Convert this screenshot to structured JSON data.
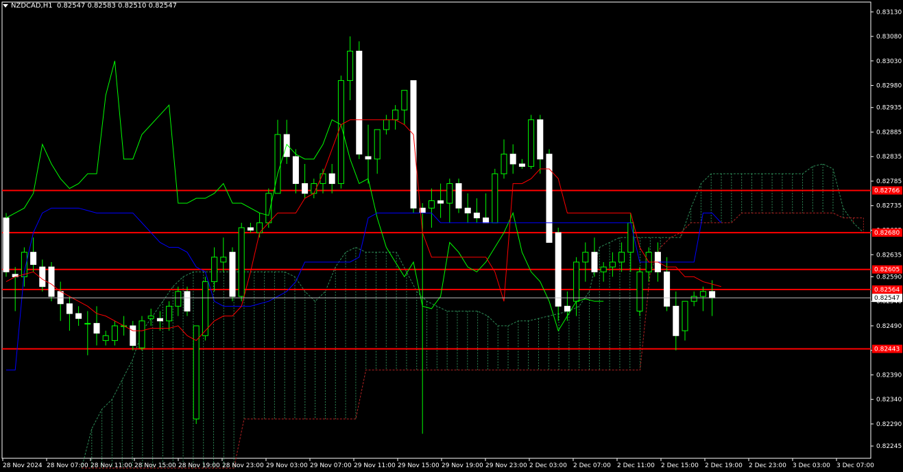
{
  "header": {
    "symbol": "NZDCAD,H1",
    "ohlc": "0.82547 0.82583 0.82510 0.82547"
  },
  "colors": {
    "background": "#000000",
    "frame": "#ffffff",
    "bull_body": "#000000",
    "bull_wick": "#00ff00",
    "bear_body": "#ffffff",
    "tenkan": "#ff0000",
    "kijun": "#0000ff",
    "chikou": "#00ff00",
    "senkou_a": "#2e8b57",
    "senkou_b": "#b22222",
    "level_line": "#ff0000",
    "level_label": "#ff0000",
    "price_label": "#ffffff"
  },
  "chart_data": {
    "type": "candlestick",
    "ylim": [
      0.8222,
      0.8315
    ],
    "y_ticks": [
      "0.83130",
      "0.83080",
      "0.83030",
      "0.82980",
      "0.82935",
      "0.82885",
      "0.82835",
      "0.82785",
      "0.82735",
      "0.82685",
      "0.82635",
      "0.82590",
      "0.82540",
      "0.82490",
      "0.82440",
      "0.82390",
      "0.82340",
      "0.82290",
      "0.82245"
    ],
    "x_labels": [
      "28 Nov 2024",
      "28 Nov 07:00",
      "28 Nov 11:00",
      "28 Nov 15:00",
      "28 Nov 19:00",
      "28 Nov 23:00",
      "29 Nov 03:00",
      "29 Nov 07:00",
      "29 Nov 11:00",
      "29 Nov 15:00",
      "29 Nov 19:00",
      "29 Nov 23:00",
      "2 Dec 03:00",
      "2 Dec 07:00",
      "2 Dec 11:00",
      "2 Dec 15:00",
      "2 Dec 19:00",
      "2 Dec 23:00",
      "3 Dec 03:00",
      "3 Dec 07:00"
    ],
    "candles": [
      [
        0.8271,
        0.8272,
        0.8259,
        0.826
      ],
      [
        0.82595,
        0.8261,
        0.8252,
        0.8259
      ],
      [
        0.8259,
        0.8265,
        0.8257,
        0.8264
      ],
      [
        0.8264,
        0.8267,
        0.826,
        0.82615
      ],
      [
        0.8261,
        0.82625,
        0.8256,
        0.8257
      ],
      [
        0.8261,
        0.8262,
        0.8254,
        0.8255
      ],
      [
        0.8256,
        0.8258,
        0.825,
        0.82535
      ],
      [
        0.82535,
        0.8255,
        0.8248,
        0.82515
      ],
      [
        0.82515,
        0.8253,
        0.8249,
        0.82505
      ],
      [
        0.82495,
        0.8252,
        0.8243,
        0.82495
      ],
      [
        0.82495,
        0.8253,
        0.8245,
        0.82475
      ],
      [
        0.8246,
        0.8248,
        0.8245,
        0.8247
      ],
      [
        0.8246,
        0.825,
        0.8245,
        0.8249
      ],
      [
        0.8249,
        0.8251,
        0.8247,
        0.8249
      ],
      [
        0.8249,
        0.825,
        0.8244,
        0.8245
      ],
      [
        0.82445,
        0.8251,
        0.8244,
        0.825
      ],
      [
        0.82505,
        0.82525,
        0.8249,
        0.8251
      ],
      [
        0.82505,
        0.8252,
        0.8248,
        0.825
      ],
      [
        0.825,
        0.8254,
        0.8248,
        0.8253
      ],
      [
        0.8253,
        0.8257,
        0.8251,
        0.8256
      ],
      [
        0.8256,
        0.8257,
        0.8251,
        0.8252
      ],
      [
        0.823,
        0.8249,
        0.8229,
        0.8249
      ],
      [
        0.8247,
        0.8259,
        0.8246,
        0.8258
      ],
      [
        0.8258,
        0.8265,
        0.8256,
        0.8263
      ],
      [
        0.8262,
        0.8267,
        0.826,
        0.8263
      ],
      [
        0.8264,
        0.8265,
        0.8254,
        0.8255
      ],
      [
        0.8255,
        0.827,
        0.8254,
        0.8269
      ],
      [
        0.8269,
        0.827,
        0.8268,
        0.82685
      ],
      [
        0.8268,
        0.8272,
        0.8267,
        0.827
      ],
      [
        0.827,
        0.8277,
        0.8269,
        0.8276
      ],
      [
        0.8276,
        0.8291,
        0.8276,
        0.8288
      ],
      [
        0.8288,
        0.8291,
        0.8282,
        0.82835
      ],
      [
        0.82835,
        0.8285,
        0.8276,
        0.8278
      ],
      [
        0.8278,
        0.8282,
        0.8275,
        0.8276
      ],
      [
        0.8276,
        0.8279,
        0.8275,
        0.8278
      ],
      [
        0.8278,
        0.8281,
        0.8276,
        0.828
      ],
      [
        0.828,
        0.8282,
        0.8276,
        0.8278
      ],
      [
        0.8278,
        0.83,
        0.8277,
        0.8299
      ],
      [
        0.8299,
        0.8308,
        0.8295,
        0.8305
      ],
      [
        0.8305,
        0.8307,
        0.8283,
        0.8284
      ],
      [
        0.82835,
        0.829,
        0.8278,
        0.8283
      ],
      [
        0.8283,
        0.8289,
        0.828,
        0.8289
      ],
      [
        0.8289,
        0.8292,
        0.8288,
        0.8291
      ],
      [
        0.8291,
        0.8294,
        0.8289,
        0.8293
      ],
      [
        0.8293,
        0.8297,
        0.829,
        0.8297
      ],
      [
        0.8299,
        0.8299,
        0.8272,
        0.8273
      ],
      [
        0.8273,
        0.8274,
        0.8227,
        0.8272
      ],
      [
        0.8273,
        0.8277,
        0.8269,
        0.82745
      ],
      [
        0.82745,
        0.8278,
        0.8271,
        0.8274
      ],
      [
        0.8274,
        0.8279,
        0.827,
        0.8278
      ],
      [
        0.8278,
        0.8279,
        0.8272,
        0.8273
      ],
      [
        0.8273,
        0.8276,
        0.827,
        0.8272
      ],
      [
        0.8272,
        0.8275,
        0.827,
        0.8271
      ],
      [
        0.8271,
        0.8276,
        0.827,
        0.827
      ],
      [
        0.827,
        0.8281,
        0.827,
        0.828
      ],
      [
        0.828,
        0.8287,
        0.8279,
        0.8284
      ],
      [
        0.8284,
        0.8286,
        0.828,
        0.8282
      ],
      [
        0.8282,
        0.8283,
        0.8281,
        0.82815
      ],
      [
        0.82815,
        0.8292,
        0.8281,
        0.8291
      ],
      [
        0.8291,
        0.8292,
        0.828,
        0.8283
      ],
      [
        0.8284,
        0.8285,
        0.8272,
        0.8266
      ],
      [
        0.8268,
        0.8269,
        0.825,
        0.8253
      ],
      [
        0.8253,
        0.8256,
        0.825,
        0.8252
      ],
      [
        0.8254,
        0.8263,
        0.8251,
        0.8262
      ],
      [
        0.8262,
        0.8266,
        0.8258,
        0.8264
      ],
      [
        0.8264,
        0.8267,
        0.8259,
        0.826
      ],
      [
        0.826,
        0.8262,
        0.8258,
        0.8261
      ],
      [
        0.8261,
        0.8264,
        0.8259,
        0.8262
      ],
      [
        0.8262,
        0.8266,
        0.826,
        0.8264
      ],
      [
        0.8264,
        0.8272,
        0.826,
        0.827
      ],
      [
        0.8252,
        0.8261,
        0.8251,
        0.826
      ],
      [
        0.826,
        0.8265,
        0.8258,
        0.8264
      ],
      [
        0.8264,
        0.8266,
        0.8258,
        0.826
      ],
      [
        0.826,
        0.8263,
        0.8252,
        0.8253
      ],
      [
        0.8253,
        0.8256,
        0.8244,
        0.8247
      ],
      [
        0.8248,
        0.8254,
        0.8246,
        0.8254
      ],
      [
        0.8254,
        0.8256,
        0.8253,
        0.8255
      ],
      [
        0.8255,
        0.8257,
        0.8252,
        0.8256
      ],
      [
        0.8256,
        0.82583,
        0.8251,
        0.82547
      ]
    ],
    "tenkan": [
      0.8258,
      0.8259,
      0.82595,
      0.826,
      0.82585,
      0.82575,
      0.8256,
      0.8255,
      0.8254,
      0.8253,
      0.82515,
      0.8251,
      0.825,
      0.8249,
      0.8248,
      0.8248,
      0.82485,
      0.82485,
      0.82485,
      0.8249,
      0.8247,
      0.8246,
      0.8248,
      0.825,
      0.8251,
      0.8251,
      0.8253,
      0.826,
      0.8268,
      0.827,
      0.8272,
      0.8272,
      0.8272,
      0.8275,
      0.8276,
      0.828,
      0.8285,
      0.829,
      0.8291,
      0.8291,
      0.8291,
      0.8291,
      0.8291,
      0.8291,
      0.829,
      0.8288,
      0.8268,
      0.8263,
      0.8263,
      0.8263,
      0.8263,
      0.8263,
      0.8263,
      0.8263,
      0.826,
      0.8254,
      0.8278,
      0.8278,
      0.8279,
      0.8281,
      0.8281,
      0.8279,
      0.8272,
      0.8272,
      0.8272,
      0.8272,
      0.8272,
      0.8272,
      0.8272,
      0.8272,
      0.8265,
      0.8262,
      0.8262,
      0.8261,
      0.8261,
      0.8259,
      0.8259,
      0.8258,
      0.82575,
      0.8257
    ],
    "kijun": [
      0.824,
      0.824,
      0.826,
      0.8268,
      0.8272,
      0.8273,
      0.8273,
      0.8273,
      0.8273,
      0.82725,
      0.8272,
      0.8272,
      0.8272,
      0.8272,
      0.8272,
      0.827,
      0.8268,
      0.8266,
      0.8265,
      0.8265,
      0.8264,
      0.8261,
      0.826,
      0.8254,
      0.8253,
      0.8253,
      0.8253,
      0.8253,
      0.82535,
      0.8254,
      0.8255,
      0.8256,
      0.8258,
      0.8262,
      0.8262,
      0.8262,
      0.8262,
      0.8262,
      0.8262,
      0.8263,
      0.8271,
      0.8272,
      0.8272,
      0.8272,
      0.8272,
      0.8272,
      0.8272,
      0.8272,
      0.827,
      0.827,
      0.827,
      0.827,
      0.827,
      0.827,
      0.827,
      0.827,
      0.827,
      0.827,
      0.827,
      0.827,
      0.827,
      0.827,
      0.827,
      0.827,
      0.827,
      0.827,
      0.827,
      0.827,
      0.827,
      0.827,
      0.8262,
      0.8262,
      0.8262,
      0.8262,
      0.8262,
      0.8262,
      0.8262,
      0.8272,
      0.8272,
      0.827
    ],
    "chikou": [
      0.8271,
      0.8272,
      0.8273,
      0.8276,
      0.8286,
      0.8282,
      0.8279,
      0.8277,
      0.8278,
      0.828,
      0.828,
      0.8296,
      0.8303,
      0.8283,
      0.8283,
      0.8288,
      0.829,
      0.8292,
      0.8294,
      0.8274,
      0.8274,
      0.8275,
      0.8275,
      0.8276,
      0.8278,
      0.8274,
      0.8274,
      0.8273,
      0.8272,
      0.82715,
      0.828,
      0.8286,
      0.8284,
      0.8283,
      0.8283,
      0.8286,
      0.8291,
      0.829,
      0.8283,
      0.8278,
      0.8279,
      0.8271,
      0.8265,
      0.8262,
      0.8259,
      0.8262,
      0.8253,
      0.82525,
      0.8255,
      0.8266,
      0.8264,
      0.8261,
      0.826,
      0.8262,
      0.8265,
      0.8268,
      0.8272,
      0.8264,
      0.826,
      0.8258,
      0.8254,
      0.8248,
      0.8251,
      0.8254,
      0.82545,
      0.8254,
      0.8254
    ],
    "senkou_a": [
      0.822,
      0.8228,
      0.8232,
      0.8234,
      0.8238,
      0.8242,
      0.8248,
      0.8251,
      0.8254,
      0.8257,
      0.8259,
      0.826,
      0.826,
      0.826,
      0.826,
      0.826,
      0.826,
      0.826,
      0.826,
      0.826,
      0.826,
      0.8259,
      0.8256,
      0.8254,
      0.8256,
      0.8261,
      0.8264,
      0.8265,
      0.8264,
      0.8264,
      0.8264,
      0.8264,
      0.826,
      0.8256,
      0.8254,
      0.8253,
      0.8252,
      0.8252,
      0.8252,
      0.8252,
      0.8251,
      0.8249,
      0.8249,
      0.825,
      0.825,
      0.82505,
      0.8251,
      0.82515,
      0.8252,
      0.8253,
      0.8256,
      0.8265,
      0.8266,
      0.8267,
      0.8267,
      0.8267,
      0.8267,
      0.8267,
      0.8267,
      0.8267,
      0.8273,
      0.8278,
      0.828,
      0.828,
      0.828,
      0.828,
      0.828,
      0.828,
      0.828,
      0.828,
      0.828,
      0.828,
      0.82815,
      0.8282,
      0.8281,
      0.8273,
      0.827,
      0.8268,
      0.8266,
      0.8263
    ],
    "senkou_b": [
      0.822,
      0.822,
      0.822,
      0.822,
      0.822,
      0.822,
      0.822,
      0.822,
      0.822,
      0.822,
      0.822,
      0.822,
      0.822,
      0.822,
      0.822,
      0.822,
      0.823,
      0.823,
      0.823,
      0.823,
      0.823,
      0.823,
      0.823,
      0.823,
      0.823,
      0.823,
      0.823,
      0.823,
      0.824,
      0.824,
      0.824,
      0.824,
      0.824,
      0.824,
      0.824,
      0.824,
      0.824,
      0.824,
      0.824,
      0.824,
      0.824,
      0.824,
      0.824,
      0.824,
      0.824,
      0.824,
      0.824,
      0.824,
      0.824,
      0.824,
      0.824,
      0.824,
      0.824,
      0.824,
      0.824,
      0.824,
      0.826,
      0.8265,
      0.8267,
      0.8268,
      0.827,
      0.827,
      0.827,
      0.827,
      0.827,
      0.8272,
      0.8272,
      0.8272,
      0.8272,
      0.8272,
      0.8272,
      0.8272,
      0.8272,
      0.8272,
      0.8272,
      0.8271,
      0.8271,
      0.8271,
      0.8271,
      0.8271
    ],
    "levels": [
      {
        "price": 0.82766,
        "label": "0.82766"
      },
      {
        "price": 0.8268,
        "label": "0.82680"
      },
      {
        "price": 0.82605,
        "label": "0.82605"
      },
      {
        "price": 0.82564,
        "label": "0.82564"
      },
      {
        "price": 0.82443,
        "label": "0.82443"
      }
    ],
    "current_price": {
      "price": 0.82547,
      "label": "0.82547"
    }
  }
}
